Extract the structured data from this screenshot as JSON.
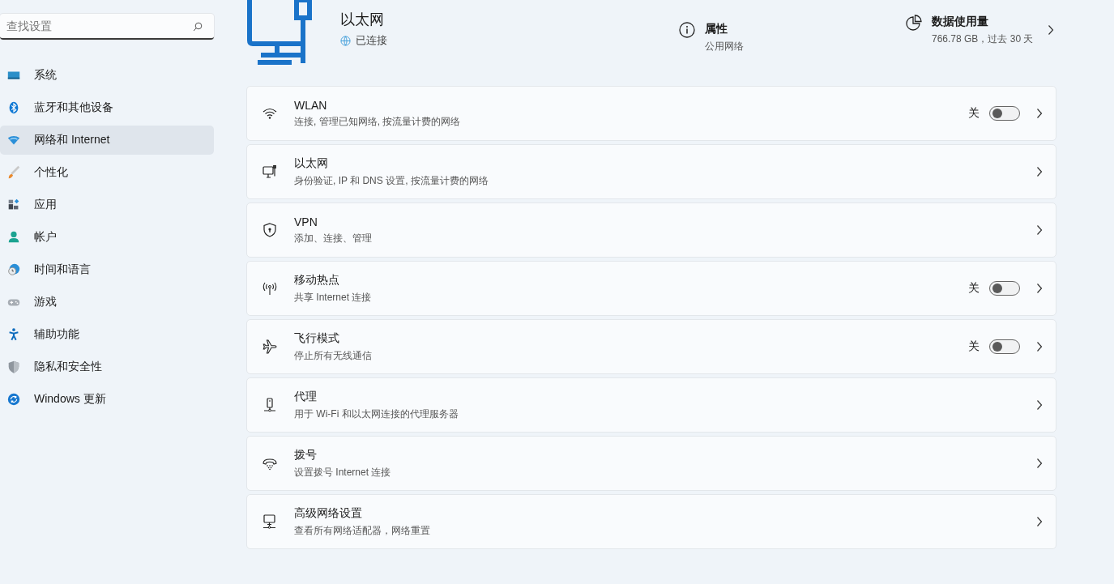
{
  "sidebar": {
    "search": {
      "placeholder": "查找设置"
    },
    "items": [
      {
        "label": "系统",
        "selected": false
      },
      {
        "label": "蓝牙和其他设备",
        "selected": false
      },
      {
        "label": "网络和 Internet",
        "selected": true
      },
      {
        "label": "个性化",
        "selected": false
      },
      {
        "label": "应用",
        "selected": false
      },
      {
        "label": "帐户",
        "selected": false
      },
      {
        "label": "时间和语言",
        "selected": false
      },
      {
        "label": "游戏",
        "selected": false
      },
      {
        "label": "辅助功能",
        "selected": false
      },
      {
        "label": "隐私和安全性",
        "selected": false
      },
      {
        "label": "Windows 更新",
        "selected": false
      }
    ]
  },
  "header": {
    "title": "以太网",
    "status": "已连接",
    "properties": {
      "title": "属性",
      "value": "公用网络"
    },
    "data_usage": {
      "title": "数据使用量",
      "value": "766.78 GB，过去 30 天"
    }
  },
  "settings": [
    {
      "title": "WLAN",
      "subtitle": "连接, 管理已知网络, 按流量计费的网络",
      "toggle": {
        "label": "关",
        "on": false
      }
    },
    {
      "title": "以太网",
      "subtitle": "身份验证, IP 和 DNS 设置, 按流量计费的网络"
    },
    {
      "title": "VPN",
      "subtitle": "添加、连接、管理"
    },
    {
      "title": "移动热点",
      "subtitle": "共享 Internet 连接",
      "toggle": {
        "label": "关",
        "on": false
      }
    },
    {
      "title": "飞行模式",
      "subtitle": "停止所有无线通信",
      "toggle": {
        "label": "关",
        "on": false
      }
    },
    {
      "title": "代理",
      "subtitle": "用于 Wi-Fi 和以太网连接的代理服务器"
    },
    {
      "title": "拨号",
      "subtitle": "设置拨号 Internet 连接"
    },
    {
      "title": "高级网络设置",
      "subtitle": "查看所有网络适配器，网络重置"
    }
  ]
}
